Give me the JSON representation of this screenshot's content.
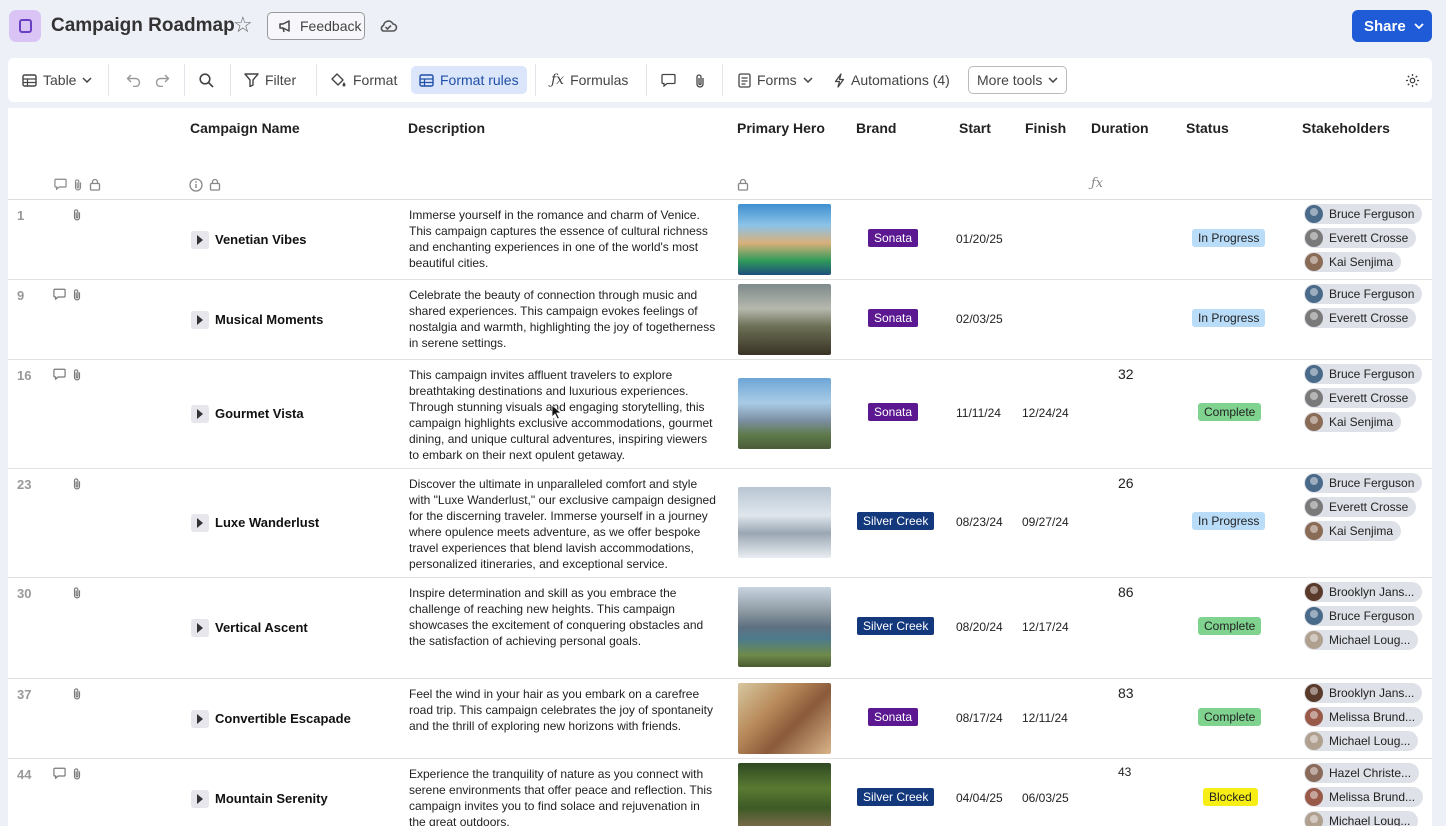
{
  "header": {
    "title": "Campaign Roadmap",
    "feedback_label": "Feedback",
    "share_label": "Share"
  },
  "toolbar": {
    "table_label": "Table",
    "filter_label": "Filter",
    "format_label": "Format",
    "format_rules_label": "Format rules",
    "formulas_label": "Formulas",
    "forms_label": "Forms",
    "automations_label": "Automations (4)",
    "more_tools_label": "More tools"
  },
  "columns": {
    "campaign_name": "Campaign Name",
    "description": "Description",
    "primary_hero": "Primary Hero",
    "brand": "Brand",
    "start": "Start",
    "finish": "Finish",
    "duration": "Duration",
    "status": "Status",
    "stakeholders": "Stakeholders"
  },
  "rows": [
    {
      "num": "1",
      "name": "Venetian Vibes",
      "description": "Immerse yourself in the romance and charm of Venice. This campaign captures the essence of cultural richness and enchanting experiences in one of the world's most beautiful cities.",
      "brand": "Sonata",
      "start": "01/20/25",
      "finish": "",
      "duration": "",
      "status": "In Progress",
      "stakeholders": [
        "Bruce Ferguson",
        "Everett Crosse",
        "Kai Senjima"
      ]
    },
    {
      "num": "9",
      "name": "Musical Moments",
      "description": "Celebrate the beauty of connection through music and shared experiences. This campaign evokes feelings of nostalgia and warmth, highlighting the joy of togetherness in serene settings.",
      "brand": "Sonata",
      "start": "02/03/25",
      "finish": "",
      "duration": "",
      "status": "In Progress",
      "stakeholders": [
        "Bruce Ferguson",
        "Everett Crosse"
      ]
    },
    {
      "num": "16",
      "name": "Gourmet Vista",
      "description": "This campaign invites affluent travelers to explore breathtaking destinations and luxurious experiences. Through stunning visuals and engaging storytelling, this campaign highlights exclusive accommodations, gourmet dining, and unique cultural adventures, inspiring viewers to embark on their next opulent getaway.",
      "brand": "Sonata",
      "start": "11/11/24",
      "finish": "12/24/24",
      "duration": "32",
      "status": "Complete",
      "stakeholders": [
        "Bruce Ferguson",
        "Everett Crosse",
        "Kai Senjima"
      ]
    },
    {
      "num": "23",
      "name": "Luxe Wanderlust",
      "description": "Discover the ultimate in unparalleled comfort and style with \"Luxe Wanderlust,\" our exclusive campaign designed for the discerning traveler. Immerse yourself in a journey where opulence meets adventure, as we offer bespoke travel experiences that blend lavish accommodations, personalized itineraries, and exceptional service.",
      "brand": "Silver Creek",
      "start": "08/23/24",
      "finish": "09/27/24",
      "duration": "26",
      "status": "In Progress",
      "stakeholders": [
        "Bruce Ferguson",
        "Everett Crosse",
        "Kai Senjima"
      ]
    },
    {
      "num": "30",
      "name": "Vertical Ascent",
      "description": "Inspire determination and skill as you embrace the challenge of reaching new heights. This campaign showcases the excitement of conquering obstacles and the satisfaction of achieving personal goals.",
      "brand": "Silver Creek",
      "start": "08/20/24",
      "finish": "12/17/24",
      "duration": "86",
      "status": "Complete",
      "stakeholders": [
        "Brooklyn Jans...",
        "Bruce Ferguson",
        "Michael Loug..."
      ]
    },
    {
      "num": "37",
      "name": "Convertible Escapade",
      "description": "Feel the wind in your hair as you embark on a carefree road trip. This campaign celebrates the joy of spontaneity and the thrill of exploring new horizons with friends.",
      "brand": "Sonata",
      "start": "08/17/24",
      "finish": "12/11/24",
      "duration": "83",
      "status": "Complete",
      "stakeholders": [
        "Brooklyn Jans...",
        "Melissa Brund...",
        "Michael Loug..."
      ]
    },
    {
      "num": "44",
      "name": "Mountain Serenity",
      "description": "Experience the tranquility of nature as you connect with serene environments that offer peace and reflection. This campaign invites you to find solace and rejuvenation in the great outdoors.",
      "brand": "Silver Creek",
      "start": "04/04/25",
      "finish": "06/03/25",
      "duration": "43",
      "status": "Blocked",
      "stakeholders": [
        "Hazel Christe...",
        "Melissa Brund...",
        "Michael Loug..."
      ]
    }
  ],
  "colors": {
    "sonata": "#5b1891",
    "silver_creek": "#13387c",
    "in_progress": "#b9dcf8",
    "complete": "#7fd38f",
    "blocked": "#f7ee16",
    "share": "#1f5bd6"
  }
}
